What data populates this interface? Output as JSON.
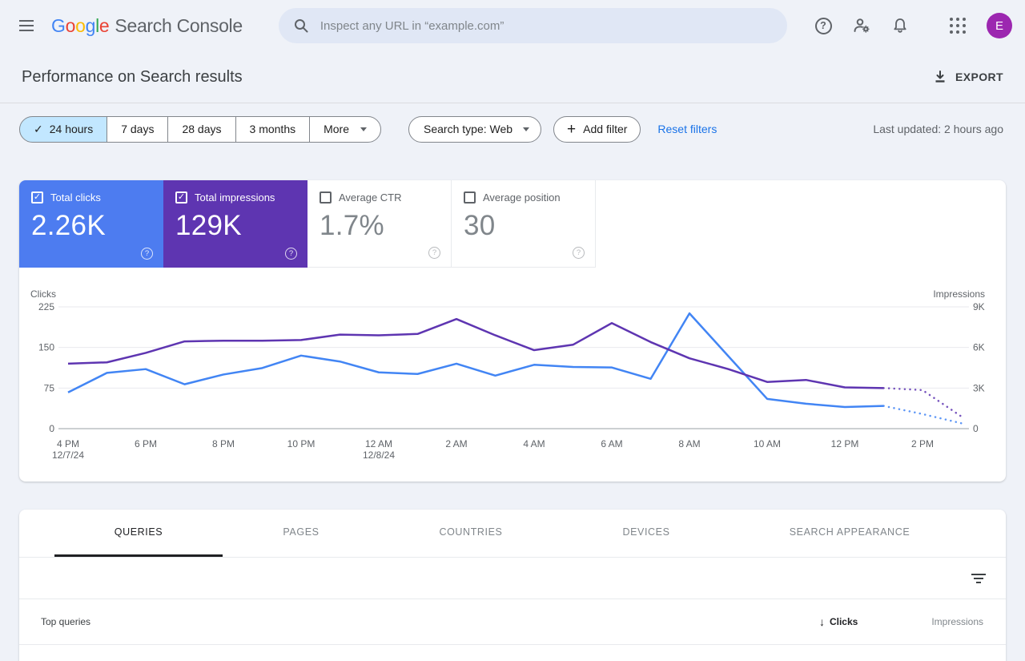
{
  "icons": {
    "check": "✓",
    "question": "?",
    "plus": "+",
    "sort_desc": "↓"
  },
  "header": {
    "product_name": "Search Console",
    "logo_letters": [
      [
        "G",
        "#4285f4"
      ],
      [
        "o",
        "#ea4335"
      ],
      [
        "o",
        "#fbbc05"
      ],
      [
        "g",
        "#4285f4"
      ],
      [
        "l",
        "#34a853"
      ],
      [
        "e",
        "#ea4335"
      ]
    ],
    "search_placeholder": "Inspect any URL in “example.com”",
    "avatar_letter": "E"
  },
  "page_header": {
    "title": "Performance on Search results",
    "export_label": "EXPORT"
  },
  "filter_bar": {
    "date_ranges": [
      {
        "label": "24 hours",
        "selected": true
      },
      {
        "label": "7 days",
        "selected": false
      },
      {
        "label": "28 days",
        "selected": false
      },
      {
        "label": "3 months",
        "selected": false
      }
    ],
    "more_label": "More",
    "search_type": "Search type: Web",
    "add_filter": "Add filter",
    "reset_filters": "Reset filters",
    "last_updated": "Last updated: 2 hours ago"
  },
  "metrics": [
    {
      "label": "Total clicks",
      "value": "2.26K",
      "checked": true,
      "bg": "#4d7cf0",
      "fg": "#ffffff"
    },
    {
      "label": "Total impressions",
      "value": "129K",
      "checked": true,
      "bg": "#5e35b1",
      "fg": "#ffffff"
    },
    {
      "label": "Average CTR",
      "value": "1.7%",
      "checked": false,
      "bg": "#ffffff",
      "fg": "#80868b"
    },
    {
      "label": "Average position",
      "value": "30",
      "checked": false,
      "bg": "#ffffff",
      "fg": "#80868b"
    }
  ],
  "chart_data": {
    "type": "line",
    "x_hours": [
      "4 PM",
      "5 PM",
      "6 PM",
      "7 PM",
      "8 PM",
      "9 PM",
      "10 PM",
      "11 PM",
      "12 AM",
      "1 AM",
      "2 AM",
      "3 AM",
      "4 AM",
      "5 AM",
      "6 AM",
      "7 AM",
      "8 AM",
      "9 AM",
      "10 AM",
      "11 AM",
      "12 PM",
      "1 PM",
      "2 PM",
      "3 PM"
    ],
    "x_ticks": [
      {
        "i": 0,
        "label": "4 PM",
        "sub": "12/7/24"
      },
      {
        "i": 2,
        "label": "6 PM",
        "sub": ""
      },
      {
        "i": 4,
        "label": "8 PM",
        "sub": ""
      },
      {
        "i": 6,
        "label": "10 PM",
        "sub": ""
      },
      {
        "i": 8,
        "label": "12 AM",
        "sub": "12/8/24"
      },
      {
        "i": 10,
        "label": "2 AM",
        "sub": ""
      },
      {
        "i": 12,
        "label": "4 AM",
        "sub": ""
      },
      {
        "i": 14,
        "label": "6 AM",
        "sub": ""
      },
      {
        "i": 16,
        "label": "8 AM",
        "sub": ""
      },
      {
        "i": 18,
        "label": "10 AM",
        "sub": ""
      },
      {
        "i": 20,
        "label": "12 PM",
        "sub": ""
      },
      {
        "i": 22,
        "label": "2 PM",
        "sub": ""
      }
    ],
    "left_axis": {
      "label": "Clicks",
      "max": 225,
      "ticks": [
        {
          "v": 225,
          "label": "225"
        },
        {
          "v": 150,
          "label": "150"
        },
        {
          "v": 75,
          "label": "75"
        },
        {
          "v": 0,
          "label": "0"
        }
      ]
    },
    "right_axis": {
      "label": "Impressions",
      "max": 9000,
      "ticks": [
        {
          "v": 9000,
          "label": "9K"
        },
        {
          "v": 6000,
          "label": "6K"
        },
        {
          "v": 3000,
          "label": "3K"
        },
        {
          "v": 0,
          "label": "0"
        }
      ]
    },
    "series": [
      {
        "name": "Clicks",
        "color": "#4285f4",
        "axis": "left",
        "solid_until_index": 21,
        "values": [
          67,
          103,
          110,
          82,
          100,
          112,
          135,
          124,
          104,
          101,
          120,
          98,
          118,
          114,
          113,
          92,
          213,
          134,
          55,
          46,
          40,
          42,
          27,
          10
        ]
      },
      {
        "name": "Impressions",
        "color": "#5e35b1",
        "axis": "right",
        "solid_until_index": 21,
        "values": [
          4800,
          4900,
          5600,
          6450,
          6500,
          6500,
          6550,
          6950,
          6900,
          7000,
          8100,
          6900,
          5800,
          6200,
          7800,
          6400,
          5200,
          4400,
          3450,
          3600,
          3050,
          3000,
          2850,
          900
        ]
      }
    ],
    "grid": true,
    "legend": "none"
  },
  "tabs": [
    {
      "label": "QUERIES",
      "active": true
    },
    {
      "label": "PAGES",
      "active": false
    },
    {
      "label": "COUNTRIES",
      "active": false
    },
    {
      "label": "DEVICES",
      "active": false
    },
    {
      "label": "SEARCH APPEARANCE",
      "active": false
    }
  ],
  "table": {
    "first_column": "Top queries",
    "sorted_column": "Clicks",
    "second_column": "Impressions"
  }
}
